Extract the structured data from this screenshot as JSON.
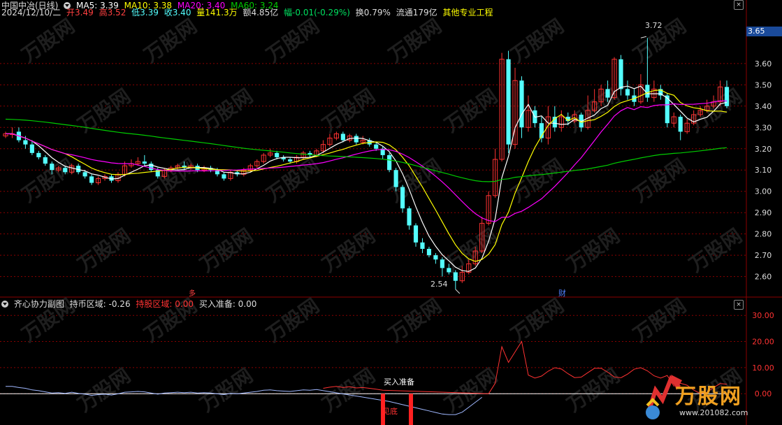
{
  "info_bar": {
    "stock_name": "中国中冶(日线)",
    "ma5": "MA5: 3.39",
    "ma10": "MA10: 3.38",
    "ma20": "MA20: 3.40",
    "ma60": "MA60: 3.24"
  },
  "quote_bar": {
    "date": "2024/12/10/二",
    "open": "开3.49",
    "high": "高3.52",
    "low": "低3.39",
    "close": "收3.40",
    "volume": "量141.3万",
    "amount": "额4.85亿",
    "change": "幅-0.01(-0.29%)",
    "turnover": "换0.79%",
    "float": "流通179亿",
    "sector": "其他专业工程"
  },
  "price_axis": [
    "3.60",
    "3.50",
    "3.40",
    "3.30",
    "3.20",
    "3.10",
    "3.00",
    "2.90",
    "2.80",
    "2.70",
    "2.60"
  ],
  "current_price": "3.65",
  "high_marker": "3.72",
  "low_marker": "2.54",
  "main_tags": {
    "left": "多",
    "fin": "财"
  },
  "sub_bar": {
    "title": "齐心协力副图",
    "hold_area": "持币区域: -0.26",
    "stock_area": "持股区域: 0.00",
    "buy_ready": "买入准备: 0.00"
  },
  "sub_axis": [
    "30.00",
    "20.00",
    "10.00",
    "0.00"
  ],
  "annotations": {
    "buy_ready": "买入准备",
    "bottom": "见底"
  },
  "watermark": {
    "brand": "万股网",
    "url": "www.201082.com"
  },
  "colors": {
    "up": "#ff3232",
    "down": "#54ffff",
    "ma5": "#ffffff",
    "ma10": "#ffff00",
    "ma20": "#ff00ff",
    "ma60": "#00cc00",
    "grid": "#8b0000"
  },
  "chart_data": {
    "type": "candlestick",
    "y_range": [
      2.52,
      3.78
    ],
    "candles": [
      [
        3.26,
        3.27,
        3.28,
        3.25
      ],
      [
        3.27,
        3.27,
        3.3,
        3.25
      ],
      [
        3.28,
        3.24,
        3.3,
        3.23
      ],
      [
        3.24,
        3.22,
        3.26,
        3.2
      ],
      [
        3.22,
        3.18,
        3.24,
        3.17
      ],
      [
        3.18,
        3.16,
        3.19,
        3.15
      ],
      [
        3.16,
        3.13,
        3.17,
        3.12
      ],
      [
        3.13,
        3.1,
        3.14,
        3.08
      ],
      [
        3.1,
        3.11,
        3.12,
        3.09
      ],
      [
        3.11,
        3.09,
        3.12,
        3.08
      ],
      [
        3.09,
        3.12,
        3.13,
        3.08
      ],
      [
        3.12,
        3.09,
        3.13,
        3.08
      ],
      [
        3.09,
        3.07,
        3.1,
        3.06
      ],
      [
        3.07,
        3.04,
        3.08,
        3.03
      ],
      [
        3.04,
        3.06,
        3.07,
        3.03
      ],
      [
        3.06,
        3.07,
        3.08,
        3.05
      ],
      [
        3.07,
        3.05,
        3.08,
        3.04
      ],
      [
        3.05,
        3.08,
        3.09,
        3.04
      ],
      [
        3.08,
        3.12,
        3.14,
        3.07
      ],
      [
        3.12,
        3.13,
        3.15,
        3.11
      ],
      [
        3.13,
        3.14,
        3.16,
        3.12
      ],
      [
        3.14,
        3.13,
        3.17,
        3.12
      ],
      [
        3.13,
        3.1,
        3.14,
        3.09
      ],
      [
        3.1,
        3.07,
        3.11,
        3.06
      ],
      [
        3.07,
        3.1,
        3.11,
        3.06
      ],
      [
        3.1,
        3.11,
        3.12,
        3.09
      ],
      [
        3.11,
        3.12,
        3.13,
        3.1
      ],
      [
        3.12,
        3.11,
        3.14,
        3.1
      ],
      [
        3.11,
        3.12,
        3.13,
        3.1
      ],
      [
        3.12,
        3.1,
        3.13,
        3.09
      ],
      [
        3.1,
        3.11,
        3.12,
        3.09
      ],
      [
        3.11,
        3.1,
        3.12,
        3.09
      ],
      [
        3.1,
        3.08,
        3.11,
        3.07
      ],
      [
        3.08,
        3.06,
        3.09,
        3.05
      ],
      [
        3.06,
        3.09,
        3.1,
        3.05
      ],
      [
        3.09,
        3.08,
        3.1,
        3.07
      ],
      [
        3.08,
        3.1,
        3.11,
        3.07
      ],
      [
        3.1,
        3.12,
        3.13,
        3.09
      ],
      [
        3.12,
        3.14,
        3.15,
        3.11
      ],
      [
        3.14,
        3.17,
        3.18,
        3.13
      ],
      [
        3.17,
        3.18,
        3.2,
        3.16
      ],
      [
        3.18,
        3.16,
        3.19,
        3.15
      ],
      [
        3.16,
        3.15,
        3.17,
        3.14
      ],
      [
        3.15,
        3.14,
        3.16,
        3.13
      ],
      [
        3.14,
        3.16,
        3.17,
        3.13
      ],
      [
        3.16,
        3.18,
        3.19,
        3.15
      ],
      [
        3.18,
        3.17,
        3.19,
        3.16
      ],
      [
        3.17,
        3.19,
        3.2,
        3.16
      ],
      [
        3.19,
        3.22,
        3.24,
        3.18
      ],
      [
        3.22,
        3.25,
        3.27,
        3.21
      ],
      [
        3.25,
        3.27,
        3.28,
        3.24
      ],
      [
        3.27,
        3.24,
        3.28,
        3.23
      ],
      [
        3.24,
        3.26,
        3.27,
        3.23
      ],
      [
        3.26,
        3.23,
        3.27,
        3.22
      ],
      [
        3.23,
        3.24,
        3.26,
        3.22
      ],
      [
        3.24,
        3.22,
        3.25,
        3.21
      ],
      [
        3.22,
        3.2,
        3.23,
        3.19
      ],
      [
        3.2,
        3.17,
        3.21,
        3.15
      ],
      [
        3.17,
        3.1,
        3.18,
        3.09
      ],
      [
        3.1,
        3.02,
        3.11,
        3.0
      ],
      [
        3.02,
        2.92,
        3.03,
        2.9
      ],
      [
        2.92,
        2.84,
        2.93,
        2.82
      ],
      [
        2.84,
        2.76,
        2.85,
        2.74
      ],
      [
        2.76,
        2.73,
        2.78,
        2.71
      ],
      [
        2.73,
        2.7,
        2.74,
        2.69
      ],
      [
        2.7,
        2.68,
        2.71,
        2.66
      ],
      [
        2.68,
        2.64,
        2.69,
        2.6
      ],
      [
        2.64,
        2.62,
        2.66,
        2.61
      ],
      [
        2.62,
        2.58,
        2.63,
        2.54
      ],
      [
        2.58,
        2.62,
        2.65,
        2.57
      ],
      [
        2.62,
        2.66,
        2.68,
        2.61
      ],
      [
        2.66,
        2.72,
        2.74,
        2.65
      ],
      [
        2.72,
        2.85,
        2.88,
        2.71
      ],
      [
        2.85,
        2.98,
        3.0,
        2.84
      ],
      [
        2.98,
        3.15,
        3.2,
        2.97
      ],
      [
        3.15,
        3.62,
        3.65,
        3.14
      ],
      [
        3.62,
        3.22,
        3.66,
        3.18
      ],
      [
        3.22,
        3.52,
        3.58,
        3.2
      ],
      [
        3.52,
        3.3,
        3.54,
        3.25
      ],
      [
        3.3,
        3.38,
        3.45,
        3.28
      ],
      [
        3.38,
        3.32,
        3.4,
        3.3
      ],
      [
        3.32,
        3.25,
        3.35,
        3.23
      ],
      [
        3.25,
        3.35,
        3.4,
        3.22
      ],
      [
        3.35,
        3.3,
        3.4,
        3.28
      ],
      [
        3.3,
        3.35,
        3.38,
        3.28
      ],
      [
        3.35,
        3.33,
        3.37,
        3.31
      ],
      [
        3.33,
        3.36,
        3.38,
        3.32
      ],
      [
        3.36,
        3.3,
        3.37,
        3.28
      ],
      [
        3.3,
        3.38,
        3.45,
        3.29
      ],
      [
        3.38,
        3.42,
        3.48,
        3.37
      ],
      [
        3.42,
        3.48,
        3.5,
        3.4
      ],
      [
        3.48,
        3.44,
        3.52,
        3.42
      ],
      [
        3.44,
        3.62,
        3.63,
        3.43
      ],
      [
        3.62,
        3.48,
        3.64,
        3.45
      ],
      [
        3.48,
        3.45,
        3.52,
        3.43
      ],
      [
        3.45,
        3.42,
        3.48,
        3.4
      ],
      [
        3.42,
        3.5,
        3.55,
        3.41
      ],
      [
        3.5,
        3.44,
        3.72,
        3.42
      ],
      [
        3.44,
        3.48,
        3.52,
        3.42
      ],
      [
        3.48,
        3.45,
        3.5,
        3.43
      ],
      [
        3.45,
        3.32,
        3.46,
        3.3
      ],
      [
        3.32,
        3.35,
        3.37,
        3.3
      ],
      [
        3.35,
        3.28,
        3.36,
        3.24
      ],
      [
        3.28,
        3.32,
        3.34,
        3.27
      ],
      [
        3.32,
        3.36,
        3.38,
        3.31
      ],
      [
        3.36,
        3.38,
        3.4,
        3.35
      ],
      [
        3.38,
        3.4,
        3.43,
        3.37
      ],
      [
        3.4,
        3.42,
        3.45,
        3.39
      ],
      [
        3.42,
        3.49,
        3.52,
        3.4
      ],
      [
        3.49,
        3.4,
        3.52,
        3.39
      ]
    ],
    "sub_series_red_peak": 20,
    "sub_range": [
      -12,
      33
    ]
  }
}
